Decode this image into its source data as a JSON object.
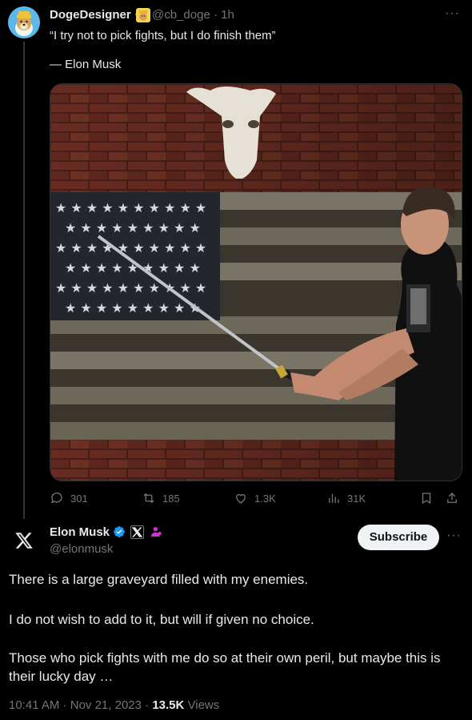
{
  "quoted_tweet": {
    "author_name": "DogeDesigner",
    "handle": "@cb_doge",
    "time": "1h",
    "separator": "·",
    "quote": "“I try not to pick fights, but I do finish them”",
    "attribution": "— Elon Musk",
    "stats": {
      "replies": "301",
      "reposts": "185",
      "likes": "1.3K",
      "views": "31K"
    }
  },
  "main_tweet": {
    "author_name": "Elon Musk",
    "handle": "@elonmusk",
    "subscribe_label": "Subscribe",
    "paragraphs": [
      "There is a large graveyard filled with my enemies.",
      "I do not wish to add to it, but will if given no choice.",
      "Those who pick fights with me do so at their own peril, but maybe this is their lucky day …"
    ],
    "time": "10:41 AM",
    "date": "Nov 21, 2023",
    "views_count": "13.5K",
    "views_label": "Views"
  },
  "colors": {
    "background": "#000000",
    "text_primary": "#e7e9ea",
    "text_secondary": "#71767b",
    "verified_blue": "#1d9bf0",
    "affiliate_purple": "#c936cc"
  },
  "icons": [
    "doge-avatar",
    "verified-badge-icon",
    "doge-affiliate-icon",
    "more-icon",
    "reply-icon",
    "repost-icon",
    "like-icon",
    "views-icon",
    "bookmark-icon",
    "share-icon",
    "x-logo-icon",
    "x-affiliate-badge-icon",
    "person-affiliate-icon"
  ]
}
